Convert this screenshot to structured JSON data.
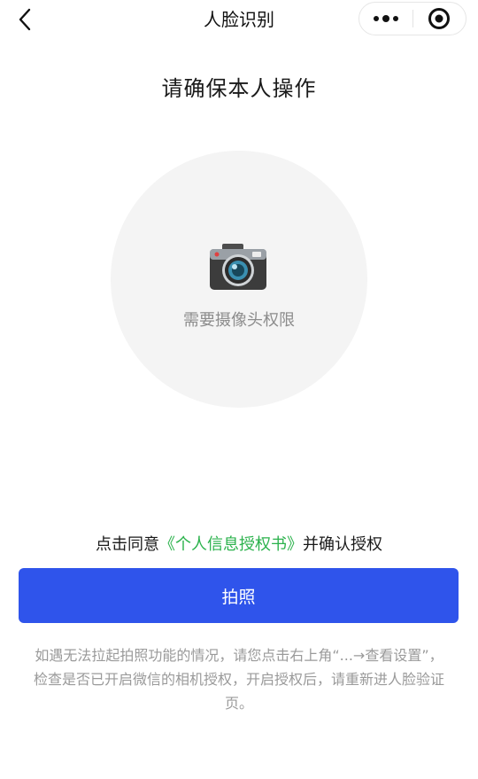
{
  "nav": {
    "title": "人脸识别",
    "back_icon": "chevron-left-icon",
    "more_icon": "more-dots-icon",
    "close_icon": "target-close-icon"
  },
  "heading": "请确保本人操作",
  "camera": {
    "icon": "camera-icon",
    "permission_text": "需要摄像头权限"
  },
  "agreement": {
    "prefix": "点击同意",
    "link": "《个人信息授权书》",
    "suffix": "并确认授权"
  },
  "primary_button": {
    "label": "拍照"
  },
  "help_text": "如遇无法拉起拍照功能的情况，请您点击右上角“...→查看设置”，检查是否已开启微信的相机授权，开启授权后，请重新进人脸验证页。",
  "colors": {
    "primary": "#2f54eb",
    "link": "#2bb24c",
    "circle_bg": "#f4f4f4",
    "muted_text": "#9a9a9a"
  }
}
